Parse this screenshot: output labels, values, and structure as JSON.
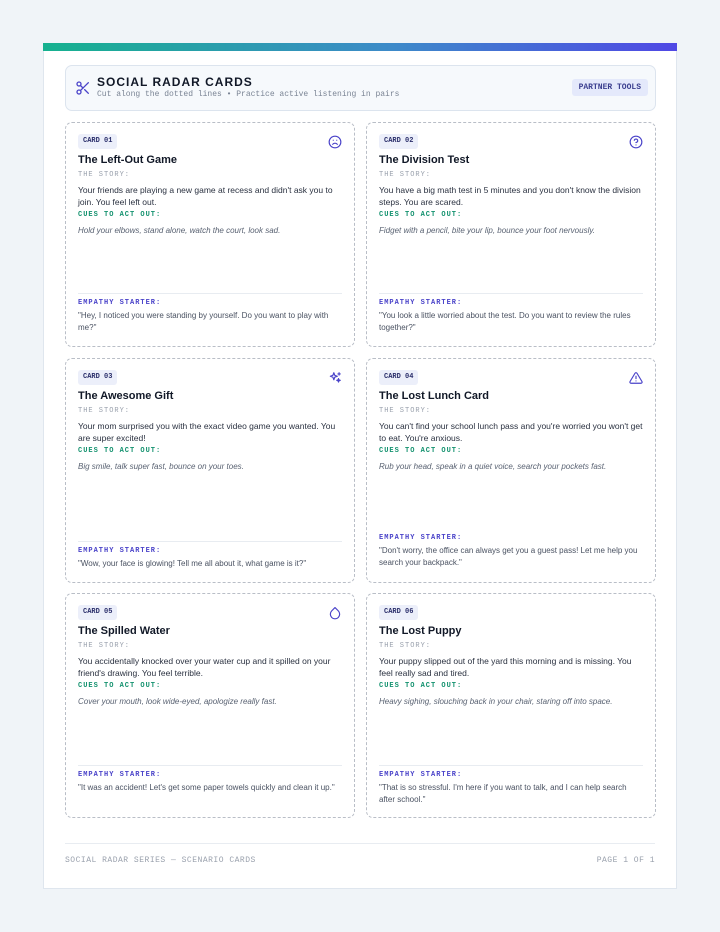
{
  "header": {
    "title": "SOCIAL RADAR CARDS",
    "subtitle": "Cut along the dotted lines • Practice active listening in pairs",
    "badge": "PARTNER TOOLS"
  },
  "labels": {
    "story": "THE STORY:",
    "cues": "CUES TO ACT OUT:",
    "empathy": "EMPATHY STARTER:"
  },
  "cards": [
    {
      "number": "CARD 01",
      "icon": "sad-face-icon",
      "title": "The Left-Out Game",
      "story": "Your friends are playing a new game at recess and didn't ask you to join. You feel left out.",
      "cues": "Hold your elbows, stand alone, watch the court, look sad.",
      "empathy": "\"Hey, I noticed you were standing by yourself. Do you want to play with me?\""
    },
    {
      "number": "CARD 02",
      "icon": "question-circle-icon",
      "title": "The Division Test",
      "story": "You have a big math test in 5 minutes and you don't know the division steps. You are scared.",
      "cues": "Fidget with a pencil, bite your lip, bounce your foot nervously.",
      "empathy": "\"You look a little worried about the test. Do you want to review the rules together?\""
    },
    {
      "number": "CARD 03",
      "icon": "sparkles-icon",
      "title": "The Awesome Gift",
      "story": "Your mom surprised you with the exact video game you wanted. You are super excited!",
      "cues": "Big smile, talk super fast, bounce on your toes.",
      "empathy": "\"Wow, your face is glowing! Tell me all about it, what game is it?\""
    },
    {
      "number": "CARD 04",
      "icon": "warning-triangle-icon",
      "title": "The Lost Lunch Card",
      "story": "You can't find your school lunch pass and you're worried you won't get to eat. You're anxious.",
      "cues": "Rub your head, speak in a quiet voice, search your pockets fast.",
      "empathy": "\"Don't worry, the office can always get you a guest pass! Let me help you search your backpack.\""
    },
    {
      "number": "CARD 05",
      "icon": "water-drop-icon",
      "title": "The Spilled Water",
      "story": "You accidentally knocked over your water cup and it spilled on your friend's drawing. You feel terrible.",
      "cues": "Cover your mouth, look wide-eyed, apologize really fast.",
      "empathy": "\"It was an accident! Let's get some paper towels quickly and clean it up.\""
    },
    {
      "number": "CARD 06",
      "icon": "",
      "title": "The Lost Puppy",
      "story": "Your puppy slipped out of the yard this morning and is missing. You feel really sad and tired.",
      "cues": "Heavy sighing, slouching back in your chair, staring off into space.",
      "empathy": "\"That is so stressful. I'm here if you want to talk, and I can help search after school.\""
    }
  ],
  "footer": {
    "left": "SOCIAL RADAR SERIES — SCENARIO CARDS",
    "right": "PAGE 1 OF 1"
  },
  "colors": {
    "accent": "#4a43c9",
    "cue_green": "#14926f",
    "gradient_start": "#16b18f",
    "gradient_end": "#5048e5"
  }
}
